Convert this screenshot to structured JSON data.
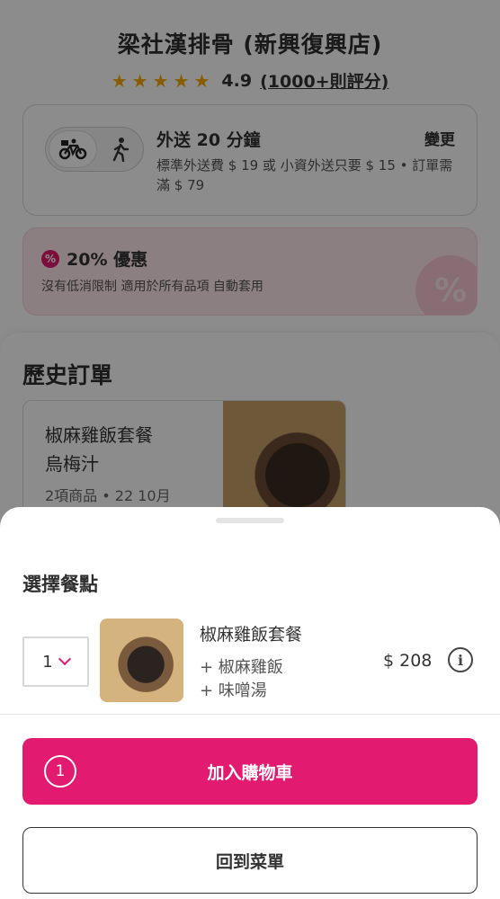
{
  "restaurant": {
    "name": "梁社漢排骨 (新興復興店)",
    "rating": "4.9",
    "rating_count": "(1000+則評分)",
    "stars": 5
  },
  "delivery": {
    "title": "外送 20 分鐘",
    "change_label": "變更",
    "fee_text": "標準外送費 $ 19 或 小資外送只要 $ 15 • 訂單需滿 $ 79",
    "modes": [
      "bicycle-icon",
      "walking-person-icon"
    ]
  },
  "promo": {
    "badge": "%",
    "title": "20% 優惠",
    "description": "沒有低消限制 適用於所有品項 自動套用"
  },
  "history": {
    "heading": "歷史訂單",
    "order": {
      "items": [
        "椒麻雞飯套餐",
        "烏梅汁"
      ],
      "meta": "2項商品 • 22 10月"
    }
  },
  "sheet": {
    "title": "選擇餐點",
    "quantity": "1",
    "item": {
      "name": "椒麻雞飯套餐",
      "addons": [
        "+ 椒麻雞飯",
        "+ 味噌湯"
      ],
      "price": "$ 208"
    },
    "info_icon_glyph": "i",
    "add_to_cart": {
      "count": "1",
      "label": "加入購物車"
    },
    "back_to_menu": "回到菜單"
  },
  "colors": {
    "brand": "#e21b70",
    "star": "#f7a800",
    "promo_bg": "#fde7ec"
  }
}
